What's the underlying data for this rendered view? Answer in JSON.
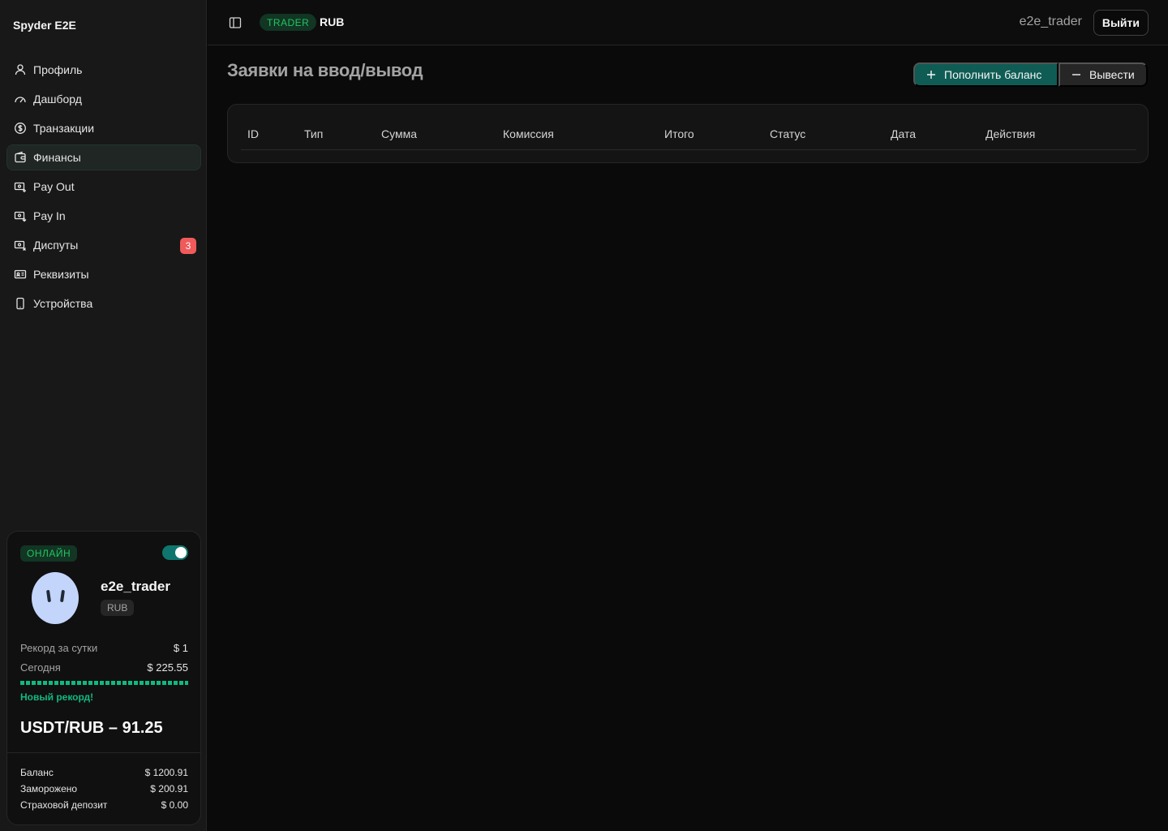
{
  "sidebar": {
    "brand": "Spyder E2E",
    "items": [
      {
        "label": "Профиль"
      },
      {
        "label": "Дашборд"
      },
      {
        "label": "Транзакции"
      },
      {
        "label": "Финансы"
      },
      {
        "label": "Pay Out"
      },
      {
        "label": "Pay In"
      },
      {
        "label": "Диспуты",
        "badge": "3"
      },
      {
        "label": "Реквизиты"
      },
      {
        "label": "Устройства"
      }
    ],
    "active_item": "Финансы"
  },
  "user_card": {
    "status": "ОНЛАЙН",
    "username": "e2e_trader",
    "currency": "RUB",
    "record_label": "Рекорд за сутки",
    "record_value": "$ 1",
    "today_label": "Сегодня",
    "today_value": "$ 225.55",
    "progress_fraction": 1.0,
    "new_record": "Новый рекорд!",
    "rate": "USDT/RUB – 91.25",
    "balance_label": "Баланс",
    "balance_value": "$ 1200.91",
    "frozen_label": "Заморожено",
    "frozen_value": "$ 200.91",
    "insurance_label": "Страховой депозит",
    "insurance_value": "$ 0.00"
  },
  "header": {
    "role": "TRADER",
    "currency": "RUB",
    "username": "e2e_trader",
    "logout": "Выйти"
  },
  "main": {
    "title": "Заявки на ввод/вывод",
    "deposit_button": "Пополнить баланс",
    "withdraw_button": "Вывести",
    "columns": [
      "ID",
      "Тип",
      "Сумма",
      "Комиссия",
      "Итого",
      "Статус",
      "Дата",
      "Действия"
    ]
  },
  "colors": {
    "accent": "#0f5c55",
    "success": "#22c55e",
    "danger": "#f05a5a"
  }
}
